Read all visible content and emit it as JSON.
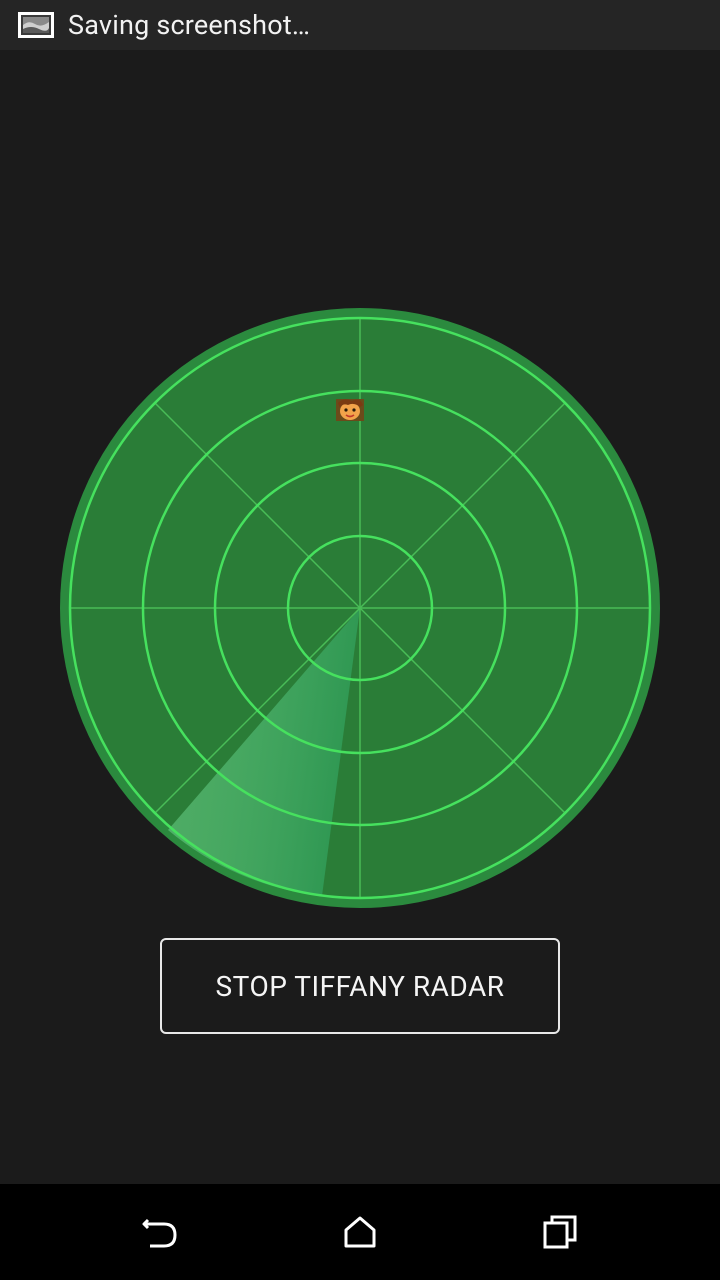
{
  "status_bar": {
    "notification_icon": "screenshot-icon",
    "text": "Saving screenshot…"
  },
  "radar": {
    "background_color": "#2a7d37",
    "ring_color": "#3fe35a",
    "sweep_color": "#66c97a",
    "blip_icon": "tiffany-face-icon"
  },
  "controls": {
    "stop_label": "STOP TIFFANY RADAR"
  },
  "nav_bar": {
    "back_icon": "back-icon",
    "home_icon": "home-icon",
    "recents_icon": "recents-icon"
  }
}
